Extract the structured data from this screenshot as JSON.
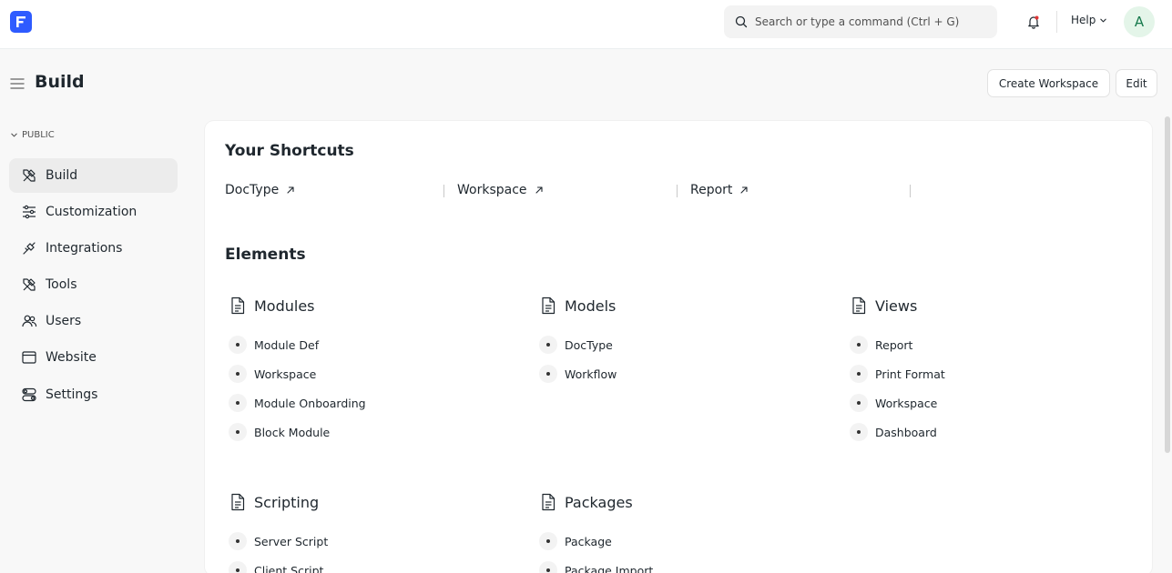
{
  "navbar": {
    "search_placeholder": "Search or type a command (Ctrl + G)",
    "help_label": "Help",
    "avatar_initial": "A"
  },
  "page": {
    "title": "Build",
    "create_workspace_label": "Create Workspace",
    "edit_label": "Edit"
  },
  "sidebar": {
    "section_label": "PUBLIC",
    "items": [
      {
        "label": "Build",
        "icon": "tools-icon",
        "active": true
      },
      {
        "label": "Customization",
        "icon": "sliders-icon"
      },
      {
        "label": "Integrations",
        "icon": "plug-icon"
      },
      {
        "label": "Tools",
        "icon": "tools-icon"
      },
      {
        "label": "Users",
        "icon": "users-icon"
      },
      {
        "label": "Website",
        "icon": "browser-icon"
      },
      {
        "label": "Settings",
        "icon": "toggles-icon"
      }
    ]
  },
  "shortcuts": {
    "title": "Your Shortcuts",
    "items": [
      "DocType",
      "Workspace",
      "Report"
    ]
  },
  "elements": {
    "title": "Elements",
    "groups": [
      {
        "title": "Modules",
        "links": [
          "Module Def",
          "Workspace",
          "Module Onboarding",
          "Block Module"
        ]
      },
      {
        "title": "Models",
        "links": [
          "DocType",
          "Workflow"
        ]
      },
      {
        "title": "Views",
        "links": [
          "Report",
          "Print Format",
          "Workspace",
          "Dashboard"
        ]
      },
      {
        "title": "Scripting",
        "links": [
          "Server Script",
          "Client Script"
        ]
      },
      {
        "title": "Packages",
        "links": [
          "Package",
          "Package Import"
        ]
      }
    ]
  },
  "colors": {
    "brand": "#2e5bff",
    "avatar_bg": "#e4f5e9",
    "avatar_text": "#16794c",
    "active_item_bg": "#ececec"
  }
}
